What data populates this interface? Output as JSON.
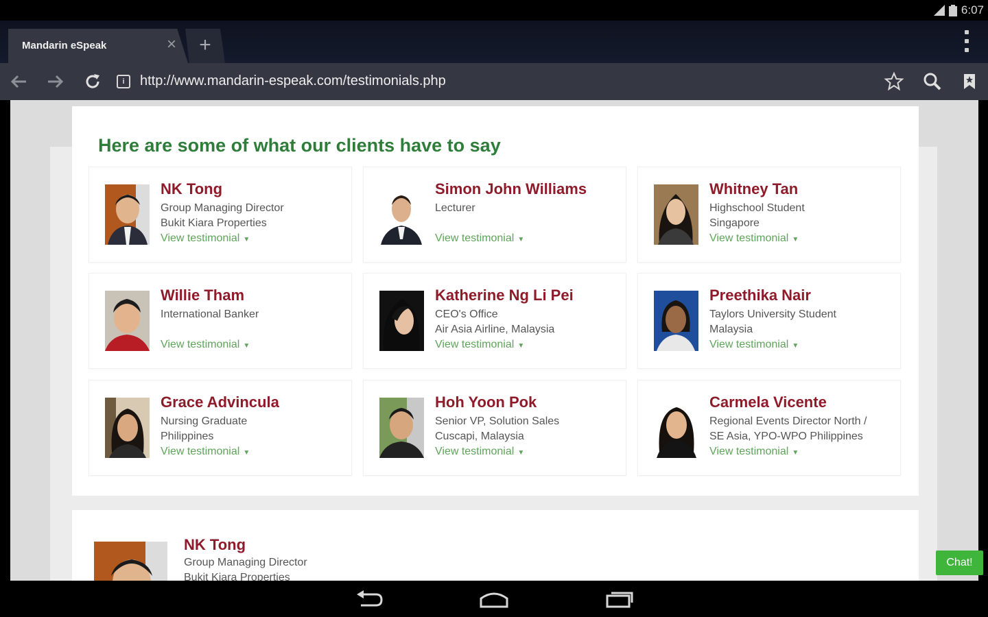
{
  "status_bar": {
    "time": "6:07"
  },
  "browser": {
    "tab_title": "Mandarin eSpeak",
    "url": "http://www.mandarin-espeak.com/testimonials.php"
  },
  "page": {
    "heading": "Here are some of what our clients have to say",
    "view_label": "View testimonial",
    "testimonials": [
      {
        "name": "NK Tong",
        "line1": "Group Managing Director",
        "line2": "Bukit Kiara Properties"
      },
      {
        "name": "Simon John Williams",
        "line1": "Lecturer",
        "line2": ""
      },
      {
        "name": "Whitney Tan",
        "line1": "Highschool Student",
        "line2": "Singapore"
      },
      {
        "name": "Willie Tham",
        "line1": "International Banker",
        "line2": ""
      },
      {
        "name": "Katherine Ng Li Pei",
        "line1": "CEO's Office",
        "line2": "Air Asia Airline, Malaysia"
      },
      {
        "name": "Preethika Nair",
        "line1": "Taylors University Student",
        "line2": "Malaysia"
      },
      {
        "name": "Grace Advincula",
        "line1": "Nursing Graduate",
        "line2": "Philippines"
      },
      {
        "name": "Hoh Yoon Pok",
        "line1": "Senior VP, Solution Sales",
        "line2": "Cuscapi, Malaysia"
      },
      {
        "name": "Carmela Vicente",
        "line1": "Regional Events Director North /",
        "line2": "SE Asia, YPO-WPO Philippines"
      }
    ],
    "detail": {
      "name": "NK Tong",
      "line1": "Group Managing Director",
      "line2": "Bukit Kiara Properties"
    },
    "chat_label": "Chat!"
  },
  "colors": {
    "heading": "#2f7d3a",
    "name": "#8e1a2a",
    "link": "#5fa45a",
    "chat": "#3fb53c"
  },
  "icons": [
    "back-icon",
    "forward-icon",
    "reload-icon",
    "bookmark-star-icon",
    "search-icon",
    "bookmarks-icon",
    "close-icon",
    "plus-icon",
    "overflow-menu-icon",
    "nav-back-icon",
    "nav-home-icon",
    "nav-recents-icon"
  ]
}
